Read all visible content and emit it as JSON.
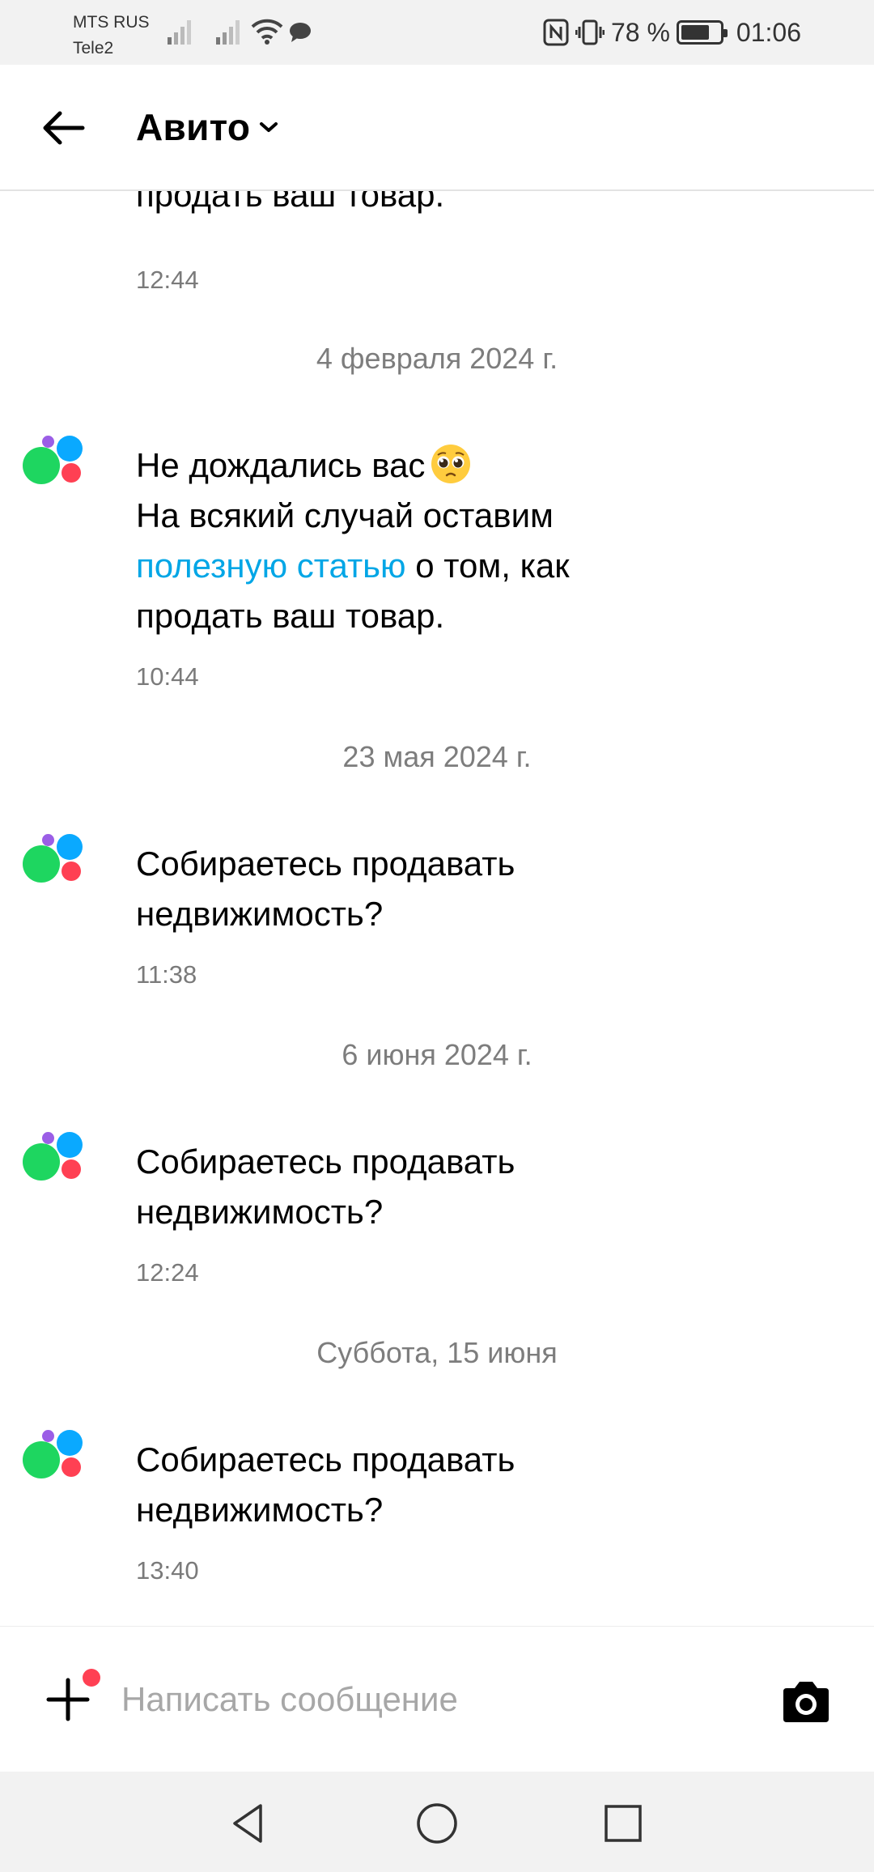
{
  "status_bar": {
    "carrier1": "MTS RUS",
    "carrier2": "Tele2",
    "battery": "78 %",
    "battery_level": 0.78,
    "time": "01:06"
  },
  "header": {
    "title": "Авито"
  },
  "messages": [
    {
      "lines": [
        "продать ваш товар."
      ],
      "time": "12:44"
    },
    {
      "date": "4 февраля 2024 г."
    },
    {
      "line1": "Не дождались вас",
      "line2": "На всякий случай оставим",
      "link": "полезную статью",
      "line3_rest": " о том, как",
      "line4": "продать ваш товар.",
      "time": "10:44"
    },
    {
      "date": "23 мая 2024 г."
    },
    {
      "line1": "Собираетесь продавать",
      "line2": "недвижимость?",
      "time": "11:38"
    },
    {
      "date": "6 июня 2024 г."
    },
    {
      "line1": "Собираетесь продавать",
      "line2": "недвижимость?",
      "time": "12:24"
    },
    {
      "date": "Суббота, 15 июня"
    },
    {
      "line1": "Собираетесь продавать",
      "line2": "недвижимость?",
      "time": "13:40"
    }
  ],
  "composer": {
    "placeholder": "Написать сообщение"
  },
  "colors": {
    "link": "#00a6e6",
    "notification_dot": "#ff4053",
    "logo_green": "#1ed660",
    "logo_blue": "#0aa9ff",
    "logo_red": "#ff4053",
    "logo_purple": "#9b5ee6"
  },
  "icons": [
    "signal-icon",
    "wifi-icon",
    "chat-bubble-icon",
    "nfc-icon",
    "vibrate-icon",
    "battery-icon",
    "back-arrow-icon",
    "chevron-down-icon",
    "avito-logo-icon",
    "pleading-face-emoji",
    "plus-icon",
    "camera-icon",
    "nav-back-icon",
    "nav-home-icon",
    "nav-recents-icon"
  ]
}
